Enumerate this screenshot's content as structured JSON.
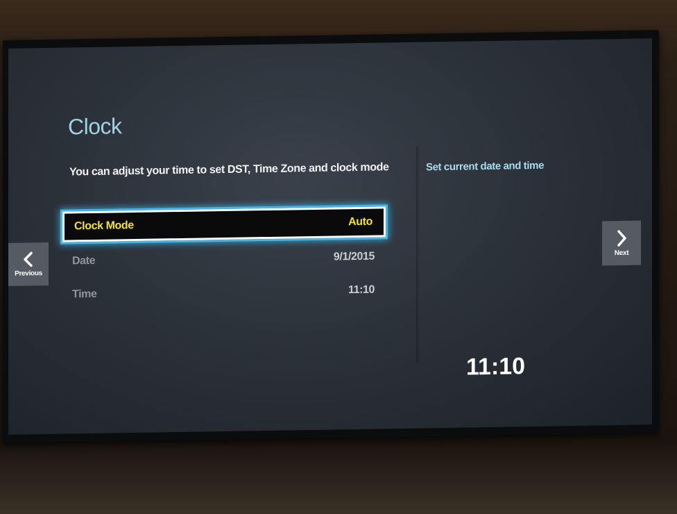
{
  "page": {
    "title": "Clock",
    "description": "You can adjust your time to set DST, Time Zone and clock mode"
  },
  "menu": [
    {
      "label": "Clock Mode",
      "value": "Auto",
      "selected": true
    },
    {
      "label": "Date",
      "value": "9/1/2015",
      "selected": false
    },
    {
      "label": "Time",
      "value": "11:10",
      "selected": false
    }
  ],
  "help": {
    "text": "Set current date and time"
  },
  "clock": {
    "display": "11:10"
  },
  "nav": {
    "previous_label": "Previous",
    "next_label": "Next",
    "previous_icon": "chevron-left-icon",
    "next_icon": "chevron-right-icon"
  },
  "colors": {
    "title": "#9fd4e6",
    "selected_text": "#f5e51b",
    "focus_glow": "#3fb7e8",
    "help_text": "#a7dce9"
  }
}
